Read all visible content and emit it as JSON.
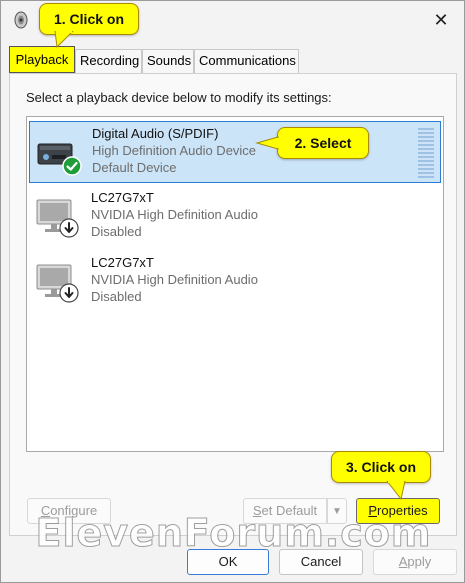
{
  "window": {
    "close_glyph": "✕"
  },
  "tabs": [
    {
      "label": "Playback",
      "active": true
    },
    {
      "label": "Recording",
      "active": false
    },
    {
      "label": "Sounds",
      "active": false
    },
    {
      "label": "Communications",
      "active": false
    }
  ],
  "panel": {
    "instructions": "Select a playback device below to modify its settings:"
  },
  "devices": [
    {
      "name": "Digital Audio (S/PDIF)",
      "description": "High Definition Audio Device",
      "status": "Default Device",
      "icon": "spdif-speaker-icon",
      "status_icon": "green-check-icon",
      "selected": true
    },
    {
      "name": "LC27G7xT",
      "description": "NVIDIA High Definition Audio",
      "status": "Disabled",
      "icon": "monitor-icon",
      "status_icon": "down-arrow-icon",
      "selected": false
    },
    {
      "name": "LC27G7xT",
      "description": "NVIDIA High Definition Audio",
      "status": "Disabled",
      "icon": "monitor-icon",
      "status_icon": "down-arrow-icon",
      "selected": false
    }
  ],
  "buttons": {
    "configure": {
      "label": "Configure",
      "accel": "C",
      "rest": "onfigure",
      "enabled": false
    },
    "set_default": {
      "label": "Set Default",
      "accel": "S",
      "rest": "et Default",
      "enabled": false
    },
    "properties": {
      "label": "Properties",
      "accel": "P",
      "rest": "roperties",
      "enabled": true
    },
    "ok": {
      "label": "OK"
    },
    "cancel": {
      "label": "Cancel"
    },
    "apply": {
      "label": "Apply",
      "accel": "A",
      "rest": "pply",
      "enabled": false
    }
  },
  "callouts": {
    "step1": "1. Click on",
    "step2": "2. Select",
    "step3": "3. Click on"
  },
  "watermark": "ElevenForum.com",
  "colors": {
    "highlight": "#ffff00",
    "selection_bg": "#cce4f7",
    "selection_border": "#2a7bd4",
    "check_green": "#1f9d3a"
  }
}
